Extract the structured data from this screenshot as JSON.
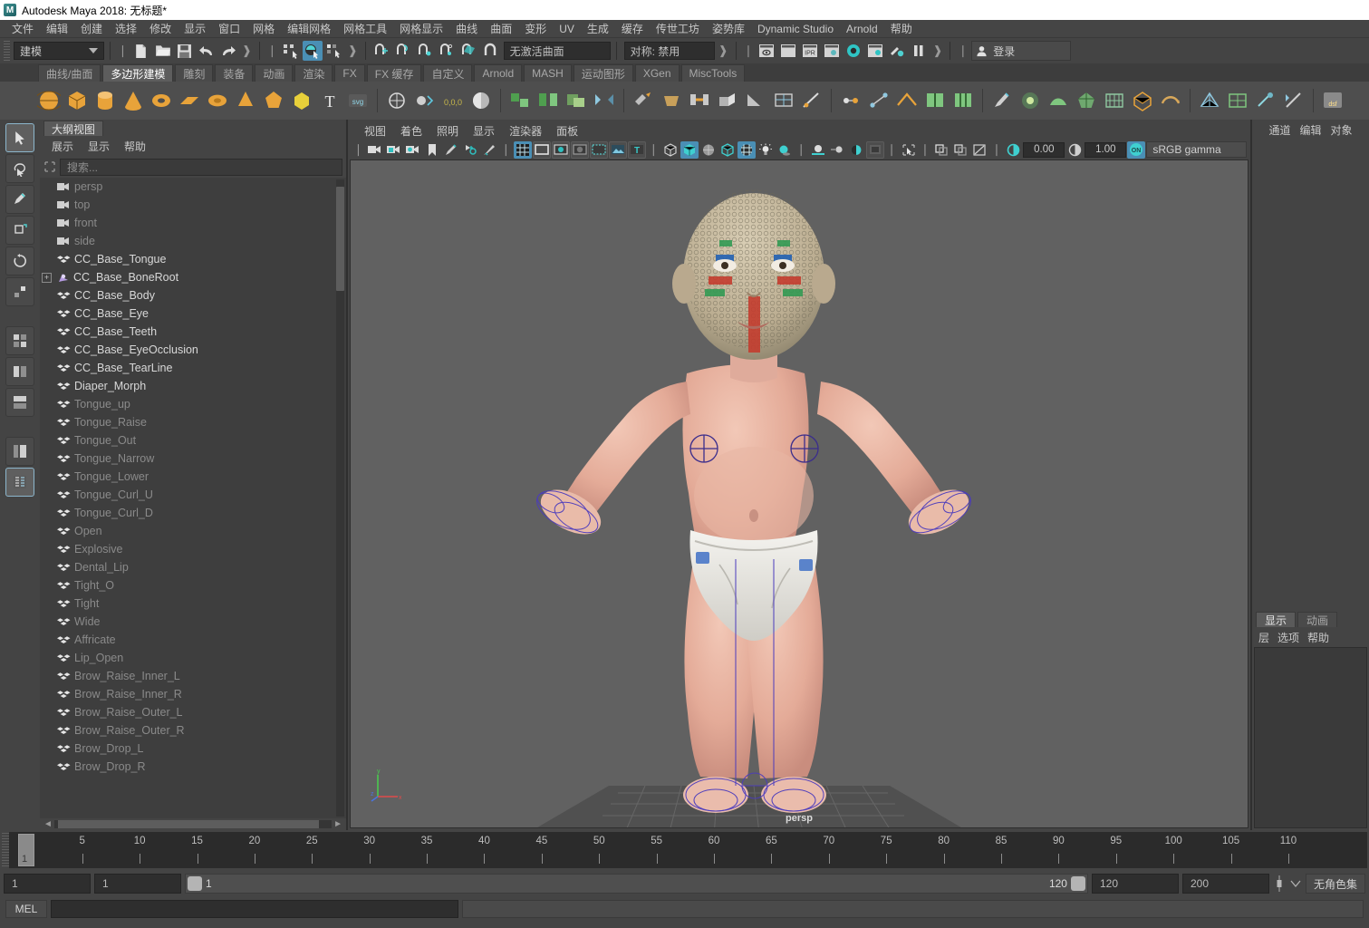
{
  "window": {
    "title": "Autodesk Maya 2018: 无标题*",
    "logo_text": "M"
  },
  "menubar": {
    "items": [
      "文件",
      "编辑",
      "创建",
      "选择",
      "修改",
      "显示",
      "窗口",
      "网格",
      "编辑网格",
      "网格工具",
      "网格显示",
      "曲线",
      "曲面",
      "变形",
      "UV",
      "生成",
      "缓存",
      "传世工坊",
      "姿势库",
      "Dynamic Studio",
      "Arnold",
      "帮助"
    ]
  },
  "statusbar": {
    "mode_menu": "建模",
    "surface_field": "无激活曲面",
    "symmetry_field": "对称: 禁用",
    "login_label": "登录",
    "icons": [
      "new-scene-icon",
      "open-scene-icon",
      "save-scene-icon",
      "undo-icon",
      "redo-icon",
      "select-by-hierarchy-icon",
      "select-by-object-icon",
      "select-by-component-icon",
      "snap-to-grid-icon",
      "snap-to-curve-icon",
      "snap-to-point-icon",
      "snap-to-projected-center-icon",
      "snap-to-view-plane-icon",
      "magnet-icon",
      "render-current-frame-icon",
      "render-sequence-icon",
      "ipr-render-icon",
      "render-settings-icon",
      "hypershade-icon",
      "render-view-icon",
      "render-setup-icon",
      "pause-icon"
    ]
  },
  "shelf": {
    "tabs": [
      "曲线/曲面",
      "多边形建模",
      "雕刻",
      "装备",
      "动画",
      "渲染",
      "FX",
      "FX 缓存",
      "自定义",
      "Arnold",
      "MASH",
      "运动图形",
      "XGen",
      "MiscTools"
    ],
    "active_tab": "多边形建模",
    "icons": [
      "poly-sphere-icon",
      "poly-cube-icon",
      "poly-cylinder-icon",
      "poly-cone-icon",
      "poly-torus-icon",
      "poly-plane-icon",
      "poly-disc-icon",
      "poly-prism-icon",
      "poly-platonic-icon",
      "poly-type-icon",
      "poly-text-icon",
      "poly-svg-icon",
      "sculpt-tool-icon",
      "snap-together-icon",
      "zero-zero-icon",
      "smooth-icon",
      "combine-icon",
      "separate-icon",
      "booleans-icon",
      "mirror-icon",
      "extract-icon",
      "bevel-icon",
      "bridge-icon",
      "extrude-icon",
      "wedge-icon",
      "quad-draw-icon",
      "multi-cut-icon",
      "target-weld-icon",
      "connect-icon",
      "crease-icon",
      "insert-edge-loop-icon",
      "offset-edge-loop-icon",
      "paint-transfer-icon",
      "soft-select-icon",
      "sculpt-mesh-icon",
      "reduce-icon",
      "remesh-icon",
      "retopologize-icon",
      "smooth-mesh-icon",
      "triangulate-icon",
      "quadrangulate-icon",
      "cleanup-icon",
      "mirror-cut-icon",
      "dsf-icon"
    ]
  },
  "left_tools": {
    "items": [
      "select-tool-icon",
      "lasso-select-icon",
      "paint-select-icon",
      "move-tool-icon",
      "rotate-tool-icon",
      "scale-tool-icon",
      "last-tool-icon",
      "layout-single-icon",
      "layout-two-pane-icon",
      "layout-four-pane-icon",
      "layout-persp-outliner-icon",
      "layout-outliner-persp-icon"
    ],
    "selected": "layout-outliner-persp-icon"
  },
  "outliner": {
    "tab_label": "大纲视图",
    "menu": [
      "展示",
      "显示",
      "帮助"
    ],
    "search_placeholder": "搜索...",
    "items": [
      {
        "label": "persp",
        "icon": "camera-icon",
        "dim": true,
        "expandable": false
      },
      {
        "label": "top",
        "icon": "camera-icon",
        "dim": true,
        "expandable": false
      },
      {
        "label": "front",
        "icon": "camera-icon",
        "dim": true,
        "expandable": false
      },
      {
        "label": "side",
        "icon": "camera-icon",
        "dim": true,
        "expandable": false
      },
      {
        "label": "CC_Base_Tongue",
        "icon": "mesh-icon",
        "dim": false,
        "expandable": false
      },
      {
        "label": "CC_Base_BoneRoot",
        "icon": "joint-icon",
        "dim": false,
        "expandable": true
      },
      {
        "label": "CC_Base_Body",
        "icon": "mesh-icon",
        "dim": false,
        "expandable": false
      },
      {
        "label": "CC_Base_Eye",
        "icon": "mesh-icon",
        "dim": false,
        "expandable": false
      },
      {
        "label": "CC_Base_Teeth",
        "icon": "mesh-icon",
        "dim": false,
        "expandable": false
      },
      {
        "label": "CC_Base_EyeOcclusion",
        "icon": "mesh-icon",
        "dim": false,
        "expandable": false
      },
      {
        "label": "CC_Base_TearLine",
        "icon": "mesh-icon",
        "dim": false,
        "expandable": false
      },
      {
        "label": "Diaper_Morph",
        "icon": "mesh-icon",
        "dim": false,
        "expandable": false
      },
      {
        "label": "Tongue_up",
        "icon": "mesh-icon",
        "dim": true,
        "expandable": false
      },
      {
        "label": "Tongue_Raise",
        "icon": "mesh-icon",
        "dim": true,
        "expandable": false
      },
      {
        "label": "Tongue_Out",
        "icon": "mesh-icon",
        "dim": true,
        "expandable": false
      },
      {
        "label": "Tongue_Narrow",
        "icon": "mesh-icon",
        "dim": true,
        "expandable": false
      },
      {
        "label": "Tongue_Lower",
        "icon": "mesh-icon",
        "dim": true,
        "expandable": false
      },
      {
        "label": "Tongue_Curl_U",
        "icon": "mesh-icon",
        "dim": true,
        "expandable": false
      },
      {
        "label": "Tongue_Curl_D",
        "icon": "mesh-icon",
        "dim": true,
        "expandable": false
      },
      {
        "label": "Open",
        "icon": "mesh-icon",
        "dim": true,
        "expandable": false
      },
      {
        "label": "Explosive",
        "icon": "mesh-icon",
        "dim": true,
        "expandable": false
      },
      {
        "label": "Dental_Lip",
        "icon": "mesh-icon",
        "dim": true,
        "expandable": false
      },
      {
        "label": "Tight_O",
        "icon": "mesh-icon",
        "dim": true,
        "expandable": false
      },
      {
        "label": "Tight",
        "icon": "mesh-icon",
        "dim": true,
        "expandable": false
      },
      {
        "label": "Wide",
        "icon": "mesh-icon",
        "dim": true,
        "expandable": false
      },
      {
        "label": "Affricate",
        "icon": "mesh-icon",
        "dim": true,
        "expandable": false
      },
      {
        "label": "Lip_Open",
        "icon": "mesh-icon",
        "dim": true,
        "expandable": false
      },
      {
        "label": "Brow_Raise_Inner_L",
        "icon": "mesh-icon",
        "dim": true,
        "expandable": false
      },
      {
        "label": "Brow_Raise_Inner_R",
        "icon": "mesh-icon",
        "dim": true,
        "expandable": false
      },
      {
        "label": "Brow_Raise_Outer_L",
        "icon": "mesh-icon",
        "dim": true,
        "expandable": false
      },
      {
        "label": "Brow_Raise_Outer_R",
        "icon": "mesh-icon",
        "dim": true,
        "expandable": false
      },
      {
        "label": "Brow_Drop_L",
        "icon": "mesh-icon",
        "dim": true,
        "expandable": false
      },
      {
        "label": "Brow_Drop_R",
        "icon": "mesh-icon",
        "dim": true,
        "expandable": false
      }
    ]
  },
  "viewport": {
    "menu": [
      "视图",
      "着色",
      "照明",
      "显示",
      "渲染器",
      "面板"
    ],
    "camera_label": "persp",
    "exposure_value": "0.00",
    "gamma_value": "1.00",
    "color_profile": "sRGB gamma",
    "axis_labels": {
      "x": "x",
      "y": "y",
      "z": "z"
    },
    "toolbar_icons": [
      "select-camera-icon",
      "lock-camera-icon",
      "camera-attributes-icon",
      "bookmark-icon",
      "grease-pencil-icon",
      "image-plane-icon",
      "camera-tool-icon",
      "grid-toggle-icon",
      "film-gate-icon",
      "resolution-gate-icon",
      "gate-mask-icon",
      "film-origin-icon",
      "image-plane-toggle-icon",
      "hud-text-icon",
      "wireframe-icon",
      "smooth-shade-icon",
      "shaded-wireframe-icon",
      "flat-shade-icon",
      "textured-icon",
      "use-lights-icon",
      "shadows-icon",
      "screen-space-ao-icon",
      "motion-blur-icon",
      "multisample-icon",
      "depth-of-field-icon",
      "isolate-select-icon",
      "xray-icon",
      "xray-joints-icon",
      "xray-active-component-icon"
    ]
  },
  "right_panel": {
    "top_menu": [
      "通道",
      "编辑",
      "对象"
    ],
    "tabs": [
      "显示",
      "动画"
    ],
    "active_tab": "显示",
    "sub_menu": [
      "层",
      "选项",
      "帮助"
    ]
  },
  "timeline": {
    "ticks": [
      5,
      10,
      15,
      20,
      25,
      30,
      35,
      40,
      45,
      50,
      55,
      60,
      65,
      70,
      75,
      80,
      85,
      90,
      95,
      100,
      105,
      110
    ],
    "current_frame": "1",
    "range_start_field": "1",
    "current_frame_field": "1",
    "range_left_label": "1",
    "range_right_label": "120",
    "end_field": "120",
    "playback_end_field": "200",
    "character_set": "无角色集"
  },
  "mel": {
    "label": "MEL",
    "command_value": ""
  }
}
